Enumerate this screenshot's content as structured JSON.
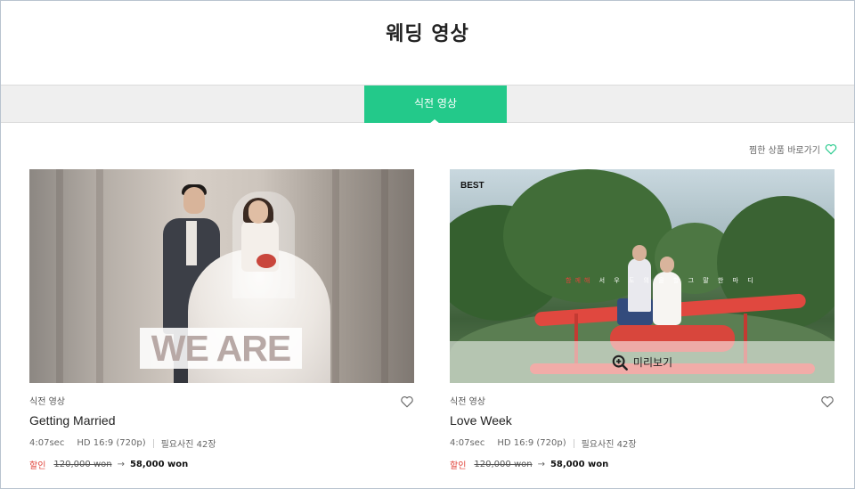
{
  "header": {
    "title": "웨딩 영상"
  },
  "tabs": [
    {
      "label": "식전 영상",
      "active": true
    }
  ],
  "wishlist_link": {
    "label": "찜한 상품 바로가기",
    "icon": "heart-outline-icon",
    "color": "#23c98a"
  },
  "accent_color": "#23c98a",
  "products": [
    {
      "thumbnail_text": "WE ARE",
      "badge": "",
      "category": "식전 영상",
      "name": "Getting Married",
      "duration": "4:07sec",
      "resolution": "HD 16:9 (720p)",
      "required_photos": "필요사진 42장",
      "sale_label": "할인",
      "original_price": "120,000 won",
      "arrow": "→",
      "sale_price": "58,000 won"
    },
    {
      "badge": "BEST",
      "caption_highlight": "함께해",
      "caption_rest": "서 우 도 의 을 할 그 말 한 마 디",
      "preview_label": "미리보기",
      "category": "식전 영상",
      "name": "Love Week",
      "duration": "4:07sec",
      "resolution": "HD 16:9 (720p)",
      "required_photos": "필요사진 42장",
      "sale_label": "할인",
      "original_price": "120,000 won",
      "arrow": "→",
      "sale_price": "58,000 won"
    }
  ]
}
